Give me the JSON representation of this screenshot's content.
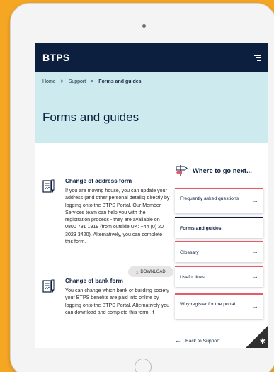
{
  "header": {
    "logo": "BTPS"
  },
  "breadcrumb": {
    "home": "Home",
    "support": "Support",
    "current": "Forms and guides",
    "separator": ">"
  },
  "page": {
    "title": "Forms and guides"
  },
  "forms": [
    {
      "title": "Change of address form",
      "description": "If you are moving house, you can update your address (and other personal details) directly by logging onto the BTPS Portal. Our Member Services team can help you with the registration process - they are available on 0800 731 1919 (from outside UK: +44 (0) 20 3023 3420). Alternatively, you can complete this form.",
      "download_label": "DOWNLOAD"
    },
    {
      "title": "Change of bank form",
      "description": "You can change which bank or building society your BTPS benefits are paid into online by logging onto the BTPS Portal. Alternatively you can download and complete this form. If"
    }
  ],
  "sidebar": {
    "heading": "Where to go next...",
    "items": [
      {
        "label": "Frequently asked questions",
        "arrow": "→"
      },
      {
        "label": "Forms and guides"
      },
      {
        "label": "Glossary",
        "arrow": "→"
      },
      {
        "label": "Useful links",
        "arrow": "→"
      },
      {
        "label": "Why register for the portal",
        "arrow": "→"
      }
    ],
    "back_label": "Back to Support",
    "back_arrow": "←"
  },
  "colors": {
    "navy": "#0c1f3f",
    "hero": "#cdeaee",
    "accent_red": "#e65a6a",
    "page_bg": "#f5a623"
  },
  "icons": {
    "menu": "hamburger-icon",
    "document": "document-icon",
    "download": "download-icon",
    "signpost": "signpost-icon",
    "settings": "gear-icon"
  }
}
